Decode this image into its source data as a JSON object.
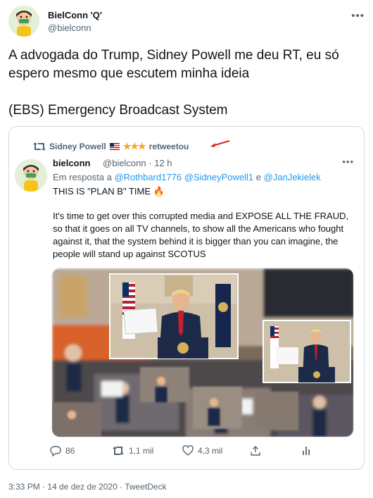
{
  "tweet": {
    "author_name": "BielConn 'Q'",
    "author_handle": "@bielconn",
    "text_line1": "A advogada do Trump, Sidney Powell me deu RT, eu só espero mesmo que escutem minha ideia",
    "text_line2": "(EBS) Emergency Broadcast System",
    "timestamp": "3:33 PM · 14 de dez de 2020 · TweetDeck"
  },
  "quote": {
    "retweeted_by": "Sidney Powell",
    "retweet_label": "retweetou",
    "author_name": "bielconn",
    "author_handle": "@bielconn",
    "time": "· 12 h",
    "reply_prefix": "Em resposta a",
    "mention_1": "@Rothbard1776",
    "mention_2": "@SidneyPowell1",
    "reply_and": "e",
    "mention_3": "@JanJekielek",
    "title": "THIS IS \"PLAN B\" TIME 🔥",
    "body": "It's time to get over this corrupted media and EXPOSE ALL THE FRAUD, so that it goes on all TV channels, to show all the Americans who fought against it, that the system behind it is bigger than you can imagine, the people will stand up against SCOTUS",
    "stars": "★★★"
  },
  "actions": {
    "replies": "86",
    "retweets": "1,1 mil",
    "likes": "4,3 mil"
  },
  "colors": {
    "link": "#1d9bf0",
    "secondary_text": "#536471",
    "border": "#cfd9de",
    "stars": "#f4a623",
    "arrow": "#e0261d"
  },
  "icons": [
    "more-icon",
    "retweet-icon",
    "us-flag-icon",
    "star-icon",
    "reply-icon",
    "like-icon",
    "share-icon",
    "analytics-icon",
    "fire-emoji"
  ]
}
